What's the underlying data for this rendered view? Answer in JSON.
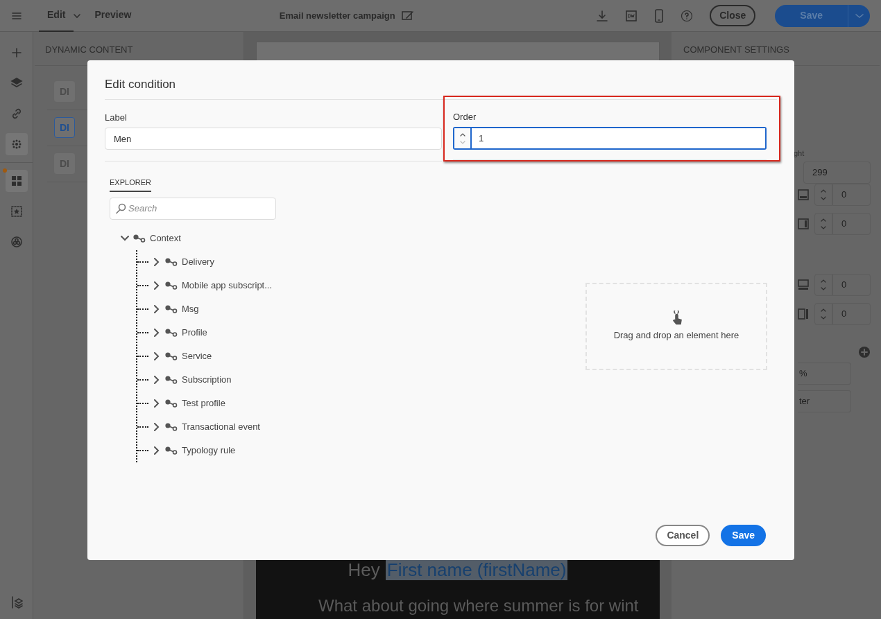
{
  "top_bar": {
    "tabs": [
      {
        "label": "Edit",
        "selected": true,
        "menu": true
      },
      {
        "label": "Preview",
        "selected": false,
        "menu": false
      }
    ],
    "title": "Email newsletter campaign",
    "close": "Close",
    "save": "Save"
  },
  "rail": {
    "items": [
      {
        "kind": "plus",
        "active": false,
        "dot": false
      },
      {
        "kind": "layers",
        "active": false,
        "dot": false
      },
      {
        "kind": "link",
        "active": false,
        "dot": false
      },
      {
        "kind": "dots",
        "active": true,
        "dot": false
      },
      {
        "kind": "grid",
        "active": true,
        "dot": true
      },
      {
        "kind": "star",
        "active": false,
        "dot": false
      },
      {
        "kind": "circle",
        "active": false,
        "dot": false
      }
    ]
  },
  "left_panel": {
    "title": "DYNAMIC CONTENT",
    "items": [
      {
        "label": "DI",
        "selected": false
      },
      {
        "label": "DI",
        "selected": true
      },
      {
        "label": "DI",
        "selected": false
      }
    ]
  },
  "editor": {
    "greeting": "Hey",
    "personalization": "First name (firstName)",
    "body": "What about going where summer is for wint"
  },
  "right_panel": {
    "title": "COMPONENT SETTINGS",
    "fields": [
      {
        "kind": "text",
        "label": "ght",
        "value": "299"
      },
      {
        "kind": "pad-bottom",
        "value": "0"
      },
      {
        "kind": "pad-right",
        "value": "0"
      },
      {
        "kind": "border-bottom",
        "value": "0"
      },
      {
        "kind": "border-right",
        "value": "0"
      },
      {
        "kind": "add"
      },
      {
        "kind": "select",
        "value": "%"
      },
      {
        "kind": "select",
        "value": "ter"
      }
    ]
  },
  "modal": {
    "title": "Edit condition",
    "label_field": {
      "label": "Label",
      "value": "Men"
    },
    "order_field": {
      "label": "Order",
      "value": "1",
      "highlighted": true
    },
    "explorer": {
      "tab": "EXPLORER",
      "search_placeholder": "Search",
      "tree": [
        {
          "label": "Context",
          "expanded": true,
          "children": [
            {
              "label": "Delivery",
              "expanded": false
            },
            {
              "label": "Mobile app subscript...",
              "expanded": false
            },
            {
              "label": "Msg",
              "expanded": false
            },
            {
              "label": "Profile",
              "expanded": false
            },
            {
              "label": "Service",
              "expanded": false
            },
            {
              "label": "Subscription",
              "expanded": false
            },
            {
              "label": "Test profile",
              "expanded": false
            },
            {
              "label": "Transactional event",
              "expanded": false
            },
            {
              "label": "Typology rule",
              "expanded": false
            }
          ]
        }
      ]
    },
    "drop_zone": "Drag and drop an element here",
    "buttons": [
      {
        "label": "Cancel",
        "kind": "secondary"
      },
      {
        "label": "Save",
        "kind": "primary"
      }
    ]
  }
}
